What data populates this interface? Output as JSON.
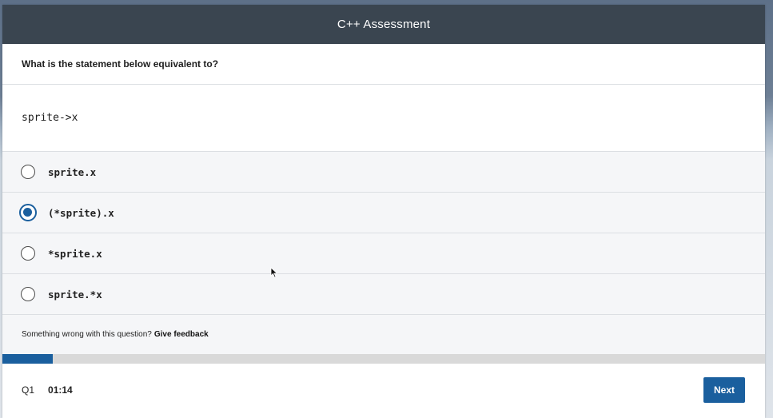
{
  "header": {
    "title": "C++ Assessment"
  },
  "question": {
    "prompt": "What is the statement below equivalent to?",
    "code": "sprite->x"
  },
  "options": [
    {
      "label": "sprite.x",
      "selected": false
    },
    {
      "label": "(*sprite).x",
      "selected": true
    },
    {
      "label": "*sprite.x",
      "selected": false
    },
    {
      "label": "sprite.*x",
      "selected": false
    }
  ],
  "feedback": {
    "text": "Something wrong with this question?",
    "link_label": "Give feedback"
  },
  "progress": {
    "fraction": 0.066,
    "color": "#1a5f9e"
  },
  "footer": {
    "question_number": "Q1",
    "timer": "01:14",
    "next_label": "Next"
  },
  "colors": {
    "accent": "#1a5f9e",
    "header_bg": "#3a4550"
  },
  "icons": {
    "radio_unselected": "radio-empty",
    "radio_selected": "radio-filled",
    "cursor": "mouse-pointer"
  }
}
